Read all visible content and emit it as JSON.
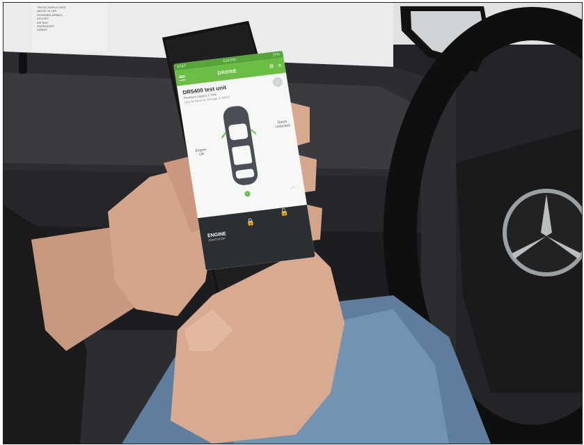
{
  "sticker": {
    "lines": [
      "TRICKS SHIELD FACE",
      "ABOVE 14 LBS",
      "SCHIEBEN AIRBAG",
      "A'ECART",
      "AIR BAG",
      "PASSENGER",
      "AIRBAG"
    ]
  },
  "phone": {
    "status": {
      "carrier": "AT&T",
      "time": "4:24 PM",
      "battery": "27%"
    },
    "app": {
      "title": "DRONE",
      "unit_name": "DR5400 test unit",
      "unit_sub": "Premium Legacy 1 Year",
      "unit_addr": "1213 W Huron St, Chicago, IL 60642",
      "engine_label": "Engine",
      "engine_state": "Off",
      "doors_label": "Doors",
      "doors_state": "Unlocked",
      "engine_button": "ENGINE",
      "engine_button_sub": "START/STOP"
    },
    "icons": {
      "menu": "menu-icon",
      "settings": "gear-icon",
      "filter": "sliders-icon",
      "info": "info-icon",
      "lock": "lock-icon",
      "unlock": "unlock-icon",
      "alert": "alert-icon",
      "expand": "chevron-up-icon"
    },
    "colors": {
      "app_green": "#6cbd45",
      "dark_panel": "#2b2e32"
    }
  },
  "car_brand": "Mercedes-Benz"
}
